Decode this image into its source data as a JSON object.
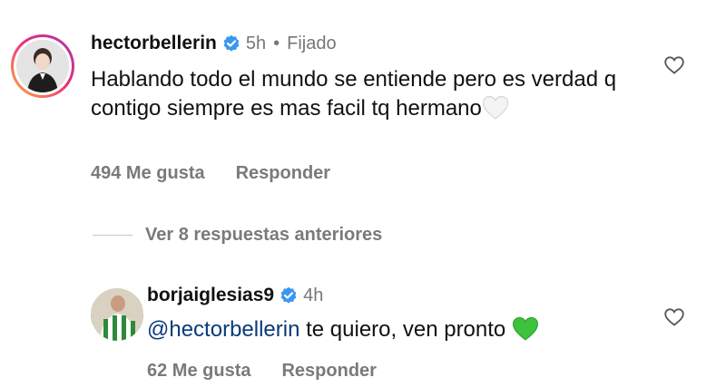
{
  "comments": [
    {
      "username": "hectorbellerin",
      "time": "5h",
      "separator": "•",
      "pinned_label": "Fijado",
      "text": "Hablando todo el mundo se entiende pero es verdad q contigo siempre es mas facil tq hermano",
      "emoji_icon": "white-heart-icon",
      "likes": "494 Me gusta",
      "reply": "Responder"
    },
    {
      "username": "borjaiglesias9",
      "time": "4h",
      "mention": "@hectorbellerin",
      "text": " te quiero, ven pronto",
      "emoji_icon": "green-heart-icon",
      "likes": "62 Me gusta",
      "reply": "Responder"
    }
  ],
  "view_more": {
    "label": "Ver 8 respuestas anteriores"
  },
  "colors": {
    "verified": "#3897f0",
    "green_heart": "#3cc23c",
    "muted_text": "#7a7a7a",
    "mention": "#0a3a7a"
  }
}
